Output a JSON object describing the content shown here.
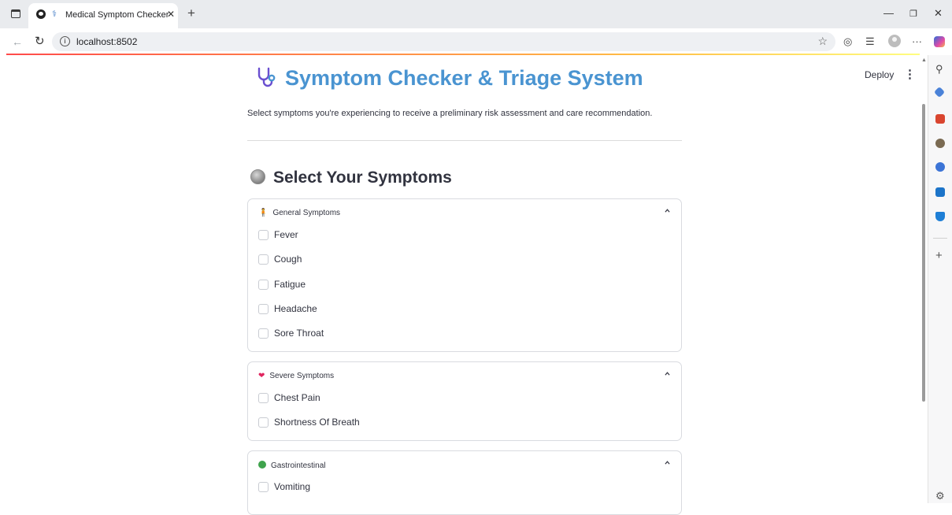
{
  "browser": {
    "tab_title": "Medical Symptom Checker",
    "url": "localhost:8502"
  },
  "header": {
    "deploy_label": "Deploy"
  },
  "page": {
    "title": "Symptom Checker & Triage System",
    "subtitle": "Select symptoms you're experiencing to receive a preliminary risk assessment and care recommendation.",
    "section_title": "Select Your Symptoms"
  },
  "groups": [
    {
      "title": "General Symptoms",
      "symptoms": [
        "Fever",
        "Cough",
        "Fatigue",
        "Headache",
        "Sore Throat"
      ]
    },
    {
      "title": "Severe Symptoms",
      "symptoms": [
        "Chest Pain",
        "Shortness Of Breath"
      ]
    },
    {
      "title": "Gastrointestinal",
      "symptoms": [
        "Vomiting"
      ]
    }
  ],
  "colors": {
    "title_blue": "#4a94d1",
    "text": "#31333f",
    "border": "#d9dbe0",
    "accent_gradient_start": "#ff4b4b",
    "accent_gradient_end": "#fffd80"
  }
}
